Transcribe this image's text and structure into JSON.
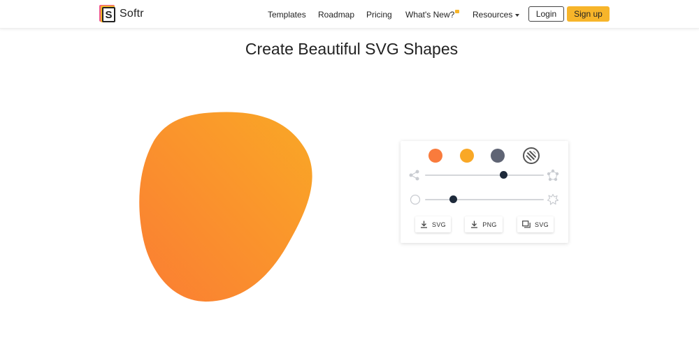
{
  "brand": {
    "logo_letter": "S",
    "name": "Softr"
  },
  "nav": {
    "templates": "Templates",
    "roadmap": "Roadmap",
    "pricing": "Pricing",
    "whats_new": "What's New?",
    "resources": "Resources"
  },
  "auth": {
    "login": "Login",
    "signup": "Sign up"
  },
  "page": {
    "title": "Create Beautiful SVG Shapes"
  },
  "colors": {
    "accent": "#f7b52a",
    "swatch_orange": "#f97b3c",
    "swatch_yellow": "#f9a826",
    "swatch_gray": "#5f6474",
    "blob_start": "#fb7d33",
    "blob_end": "#f9a826"
  },
  "controls": {
    "swatches": [
      "swatch-orange",
      "swatch-yellow",
      "swatch-gray",
      "swatch-gradient"
    ],
    "complexity_slider_value": 0.66,
    "contrast_slider_value": 0.24,
    "download_svg_label": "SVG",
    "download_png_label": "PNG",
    "copy_svg_label": "SVG"
  }
}
